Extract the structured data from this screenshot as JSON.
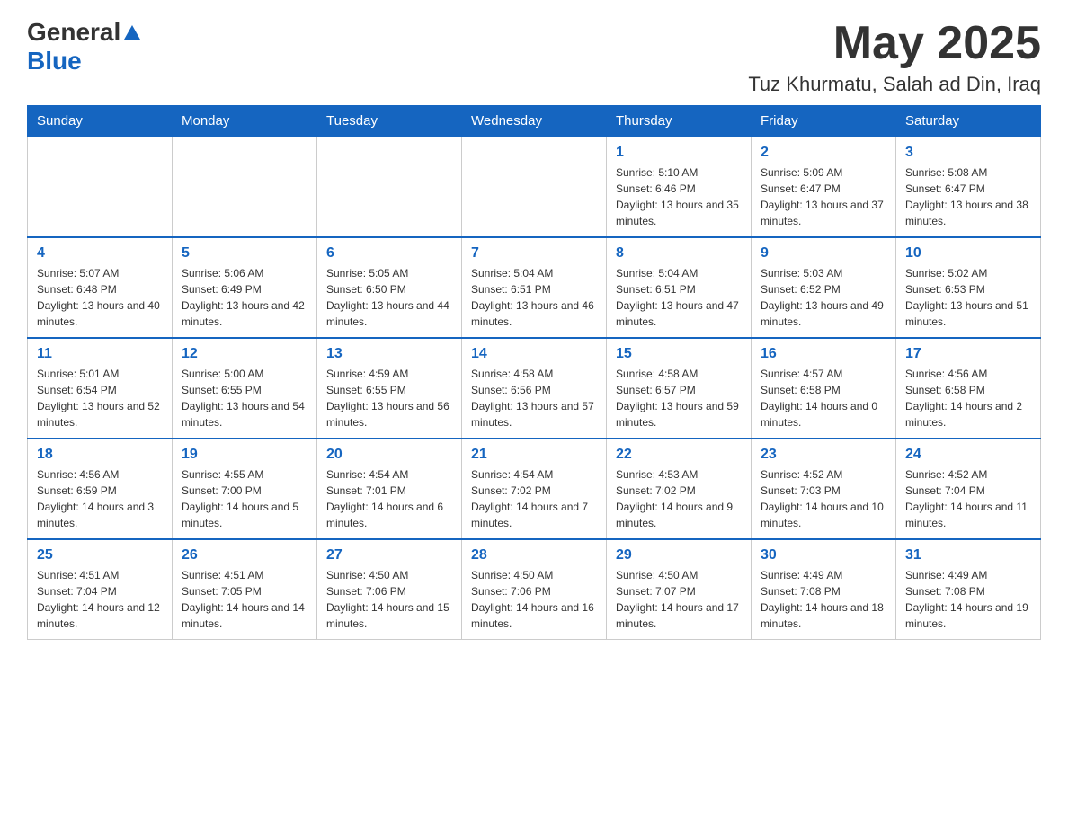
{
  "header": {
    "logo_general": "General",
    "logo_blue": "Blue",
    "month_title": "May 2025",
    "location": "Tuz Khurmatu, Salah ad Din, Iraq"
  },
  "days_of_week": [
    "Sunday",
    "Monday",
    "Tuesday",
    "Wednesday",
    "Thursday",
    "Friday",
    "Saturday"
  ],
  "weeks": [
    [
      {
        "day": "",
        "info": ""
      },
      {
        "day": "",
        "info": ""
      },
      {
        "day": "",
        "info": ""
      },
      {
        "day": "",
        "info": ""
      },
      {
        "day": "1",
        "info": "Sunrise: 5:10 AM\nSunset: 6:46 PM\nDaylight: 13 hours and 35 minutes."
      },
      {
        "day": "2",
        "info": "Sunrise: 5:09 AM\nSunset: 6:47 PM\nDaylight: 13 hours and 37 minutes."
      },
      {
        "day": "3",
        "info": "Sunrise: 5:08 AM\nSunset: 6:47 PM\nDaylight: 13 hours and 38 minutes."
      }
    ],
    [
      {
        "day": "4",
        "info": "Sunrise: 5:07 AM\nSunset: 6:48 PM\nDaylight: 13 hours and 40 minutes."
      },
      {
        "day": "5",
        "info": "Sunrise: 5:06 AM\nSunset: 6:49 PM\nDaylight: 13 hours and 42 minutes."
      },
      {
        "day": "6",
        "info": "Sunrise: 5:05 AM\nSunset: 6:50 PM\nDaylight: 13 hours and 44 minutes."
      },
      {
        "day": "7",
        "info": "Sunrise: 5:04 AM\nSunset: 6:51 PM\nDaylight: 13 hours and 46 minutes."
      },
      {
        "day": "8",
        "info": "Sunrise: 5:04 AM\nSunset: 6:51 PM\nDaylight: 13 hours and 47 minutes."
      },
      {
        "day": "9",
        "info": "Sunrise: 5:03 AM\nSunset: 6:52 PM\nDaylight: 13 hours and 49 minutes."
      },
      {
        "day": "10",
        "info": "Sunrise: 5:02 AM\nSunset: 6:53 PM\nDaylight: 13 hours and 51 minutes."
      }
    ],
    [
      {
        "day": "11",
        "info": "Sunrise: 5:01 AM\nSunset: 6:54 PM\nDaylight: 13 hours and 52 minutes."
      },
      {
        "day": "12",
        "info": "Sunrise: 5:00 AM\nSunset: 6:55 PM\nDaylight: 13 hours and 54 minutes."
      },
      {
        "day": "13",
        "info": "Sunrise: 4:59 AM\nSunset: 6:55 PM\nDaylight: 13 hours and 56 minutes."
      },
      {
        "day": "14",
        "info": "Sunrise: 4:58 AM\nSunset: 6:56 PM\nDaylight: 13 hours and 57 minutes."
      },
      {
        "day": "15",
        "info": "Sunrise: 4:58 AM\nSunset: 6:57 PM\nDaylight: 13 hours and 59 minutes."
      },
      {
        "day": "16",
        "info": "Sunrise: 4:57 AM\nSunset: 6:58 PM\nDaylight: 14 hours and 0 minutes."
      },
      {
        "day": "17",
        "info": "Sunrise: 4:56 AM\nSunset: 6:58 PM\nDaylight: 14 hours and 2 minutes."
      }
    ],
    [
      {
        "day": "18",
        "info": "Sunrise: 4:56 AM\nSunset: 6:59 PM\nDaylight: 14 hours and 3 minutes."
      },
      {
        "day": "19",
        "info": "Sunrise: 4:55 AM\nSunset: 7:00 PM\nDaylight: 14 hours and 5 minutes."
      },
      {
        "day": "20",
        "info": "Sunrise: 4:54 AM\nSunset: 7:01 PM\nDaylight: 14 hours and 6 minutes."
      },
      {
        "day": "21",
        "info": "Sunrise: 4:54 AM\nSunset: 7:02 PM\nDaylight: 14 hours and 7 minutes."
      },
      {
        "day": "22",
        "info": "Sunrise: 4:53 AM\nSunset: 7:02 PM\nDaylight: 14 hours and 9 minutes."
      },
      {
        "day": "23",
        "info": "Sunrise: 4:52 AM\nSunset: 7:03 PM\nDaylight: 14 hours and 10 minutes."
      },
      {
        "day": "24",
        "info": "Sunrise: 4:52 AM\nSunset: 7:04 PM\nDaylight: 14 hours and 11 minutes."
      }
    ],
    [
      {
        "day": "25",
        "info": "Sunrise: 4:51 AM\nSunset: 7:04 PM\nDaylight: 14 hours and 12 minutes."
      },
      {
        "day": "26",
        "info": "Sunrise: 4:51 AM\nSunset: 7:05 PM\nDaylight: 14 hours and 14 minutes."
      },
      {
        "day": "27",
        "info": "Sunrise: 4:50 AM\nSunset: 7:06 PM\nDaylight: 14 hours and 15 minutes."
      },
      {
        "day": "28",
        "info": "Sunrise: 4:50 AM\nSunset: 7:06 PM\nDaylight: 14 hours and 16 minutes."
      },
      {
        "day": "29",
        "info": "Sunrise: 4:50 AM\nSunset: 7:07 PM\nDaylight: 14 hours and 17 minutes."
      },
      {
        "day": "30",
        "info": "Sunrise: 4:49 AM\nSunset: 7:08 PM\nDaylight: 14 hours and 18 minutes."
      },
      {
        "day": "31",
        "info": "Sunrise: 4:49 AM\nSunset: 7:08 PM\nDaylight: 14 hours and 19 minutes."
      }
    ]
  ]
}
